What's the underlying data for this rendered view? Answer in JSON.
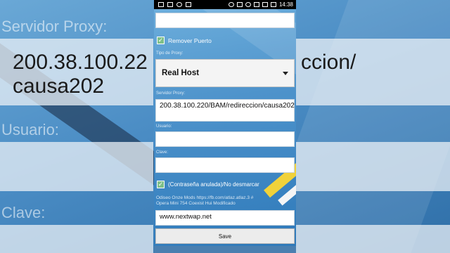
{
  "background": {
    "label_proxy": "Servidor Proxy:",
    "proxy_text": "200.38.100.220/BAM/redireccion/\ncausa202",
    "label_user": "Usuario:",
    "label_pass": "Clave:"
  },
  "statusbar": {
    "time": "14:38"
  },
  "form": {
    "remove_port_label": "Remover Puerto",
    "proxy_type_label": "Tipo de Proxy:",
    "proxy_type_value": "Real Host",
    "proxy_server_label": "Servidor Proxy:",
    "proxy_server_value": "200.38.100.220/BAM/redireccion/causa202",
    "user_label": "Usuario:",
    "user_value": "",
    "pass_label": "Clave:",
    "pass_value": "",
    "nullify_label": "(Contraseña anulada)/No desmarcar",
    "credit_line1": "Odiseo Onze Mods  https://fb.com/atlaz.atlaz.3  #",
    "credit_line2": "Opera Mini 754 Coexist  Hui Modificado",
    "host_value": "www.nextwap.net",
    "save_label": "Save"
  },
  "colors": {
    "checkbox": "#7ec089",
    "accent_yellow": "#f1d23a"
  }
}
